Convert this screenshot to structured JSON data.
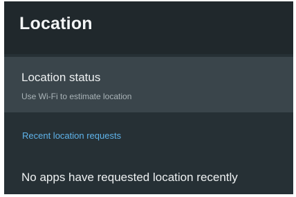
{
  "header": {
    "title": "Location"
  },
  "location_status": {
    "title": "Location status",
    "summary": "Use Wi-Fi to estimate location"
  },
  "recent_requests": {
    "section_title": "Recent location requests",
    "empty_message": "No apps have requested location recently"
  },
  "colors": {
    "background": "#263035",
    "header_background": "#20282c",
    "selected_row_background": "#3a454b",
    "primary_text": "#eef1f2",
    "secondary_text": "#aab4b8",
    "accent": "#5fb3ea"
  }
}
